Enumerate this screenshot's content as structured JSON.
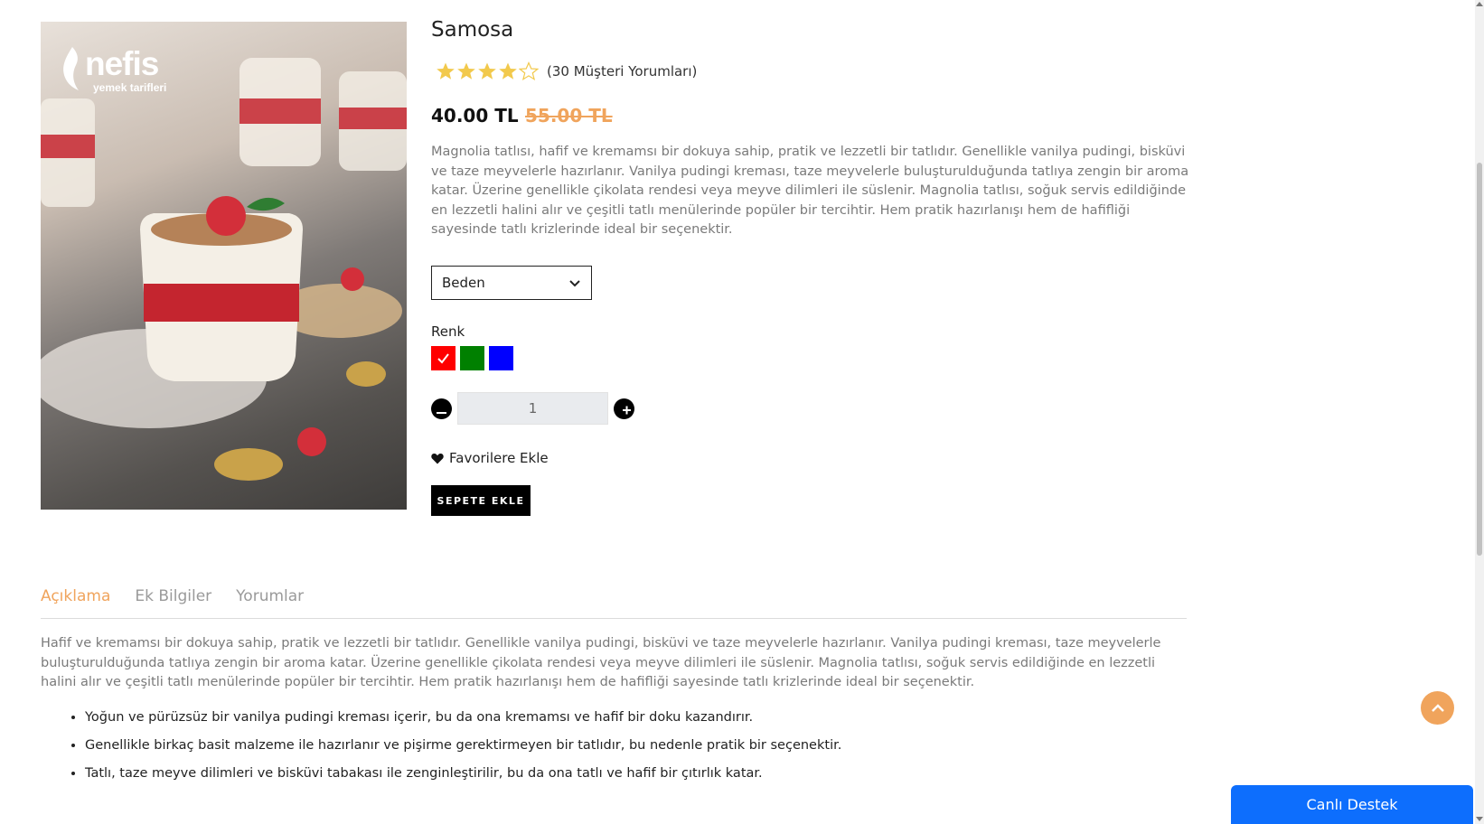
{
  "product": {
    "title": "Samosa",
    "rating": 4,
    "rating_max": 5,
    "review_count_text": "(30 Müşteri Yorumları)",
    "price": "40.00 TL",
    "old_price": "55.00 TL",
    "description": "Magnolia tatlısı, hafif ve kremamsı bir dokuya sahip, pratik ve lezzetli bir tatlıdır. Genellikle vanilya pudingi, bisküvi ve taze meyvelerle hazırlanır. Vanilya pudingi kreması, taze meyvelerle buluşturulduğunda tatlıya zengin bir aroma katar. Üzerine genellikle çikolata rendesi veya meyve dilimleri ile süslenir. Magnolia tatlısı, soğuk servis edildiğinde en lezzetli halini alır ve çeşitli tatlı menülerinde popüler bir tercihtir. Hem pratik hazırlanışı hem de hafifliği sayesinde tatlı krizlerinde ideal bir seçenektir.",
    "size_select": "Beden",
    "color_label": "Renk",
    "colors": [
      {
        "name": "red",
        "hex": "#ff0000",
        "selected": true
      },
      {
        "name": "green",
        "hex": "#008000",
        "selected": false
      },
      {
        "name": "blue",
        "hex": "#0000ff",
        "selected": false
      }
    ],
    "quantity": "1",
    "favorite_label": "Favorilere Ekle",
    "add_to_cart_label": "SEPETE EKLE"
  },
  "brand": {
    "name": "nefis",
    "subtitle": "yemek tarifleri"
  },
  "tabs": [
    {
      "label": "Açıklama",
      "active": true
    },
    {
      "label": "Ek Bilgiler",
      "active": false
    },
    {
      "label": "Yorumlar",
      "active": false
    }
  ],
  "tab_content": {
    "paragraph": "Hafif ve kremamsı bir dokuya sahip, pratik ve lezzetli bir tatlıdır. Genellikle vanilya pudingi, bisküvi ve taze meyvelerle hazırlanır. Vanilya pudingi kreması, taze meyvelerle buluşturulduğunda tatlıya zengin bir aroma katar. Üzerine genellikle çikolata rendesi veya meyve dilimleri ile süslenir. Magnolia tatlısı, soğuk servis edildiğinde en lezzetli halini alır ve çeşitli tatlı menülerinde popüler bir tercihtir. Hem pratik hazırlanışı hem de hafifliği sayesinde tatlı krizlerinde ideal bir seçenektir.",
    "features": [
      "Yoğun ve pürüzsüz bir vanilya pudingi kreması içerir, bu da ona kremamsı ve hafif bir doku kazandırır.",
      "Genellikle birkaç basit malzeme ile hazırlanır ve pişirme gerektirmeyen bir tatlıdır, bu nedenle pratik bir seçenektir.",
      "Tatlı, taze meyve dilimleri ve bisküvi tabakası ile zenginleştirilir, bu da ona tatlı ve hafif bir çıtırlık katar."
    ]
  },
  "live_support_label": "Canlı Destek",
  "colors": {
    "accent": "#f0a45c",
    "support": "#0d6efd",
    "star": "#f2c94c"
  },
  "icons": [
    "chevron-down-icon",
    "check-icon",
    "minus-icon",
    "plus-icon",
    "heart-icon",
    "star-icon",
    "chevron-up-icon",
    "flame-icon"
  ]
}
